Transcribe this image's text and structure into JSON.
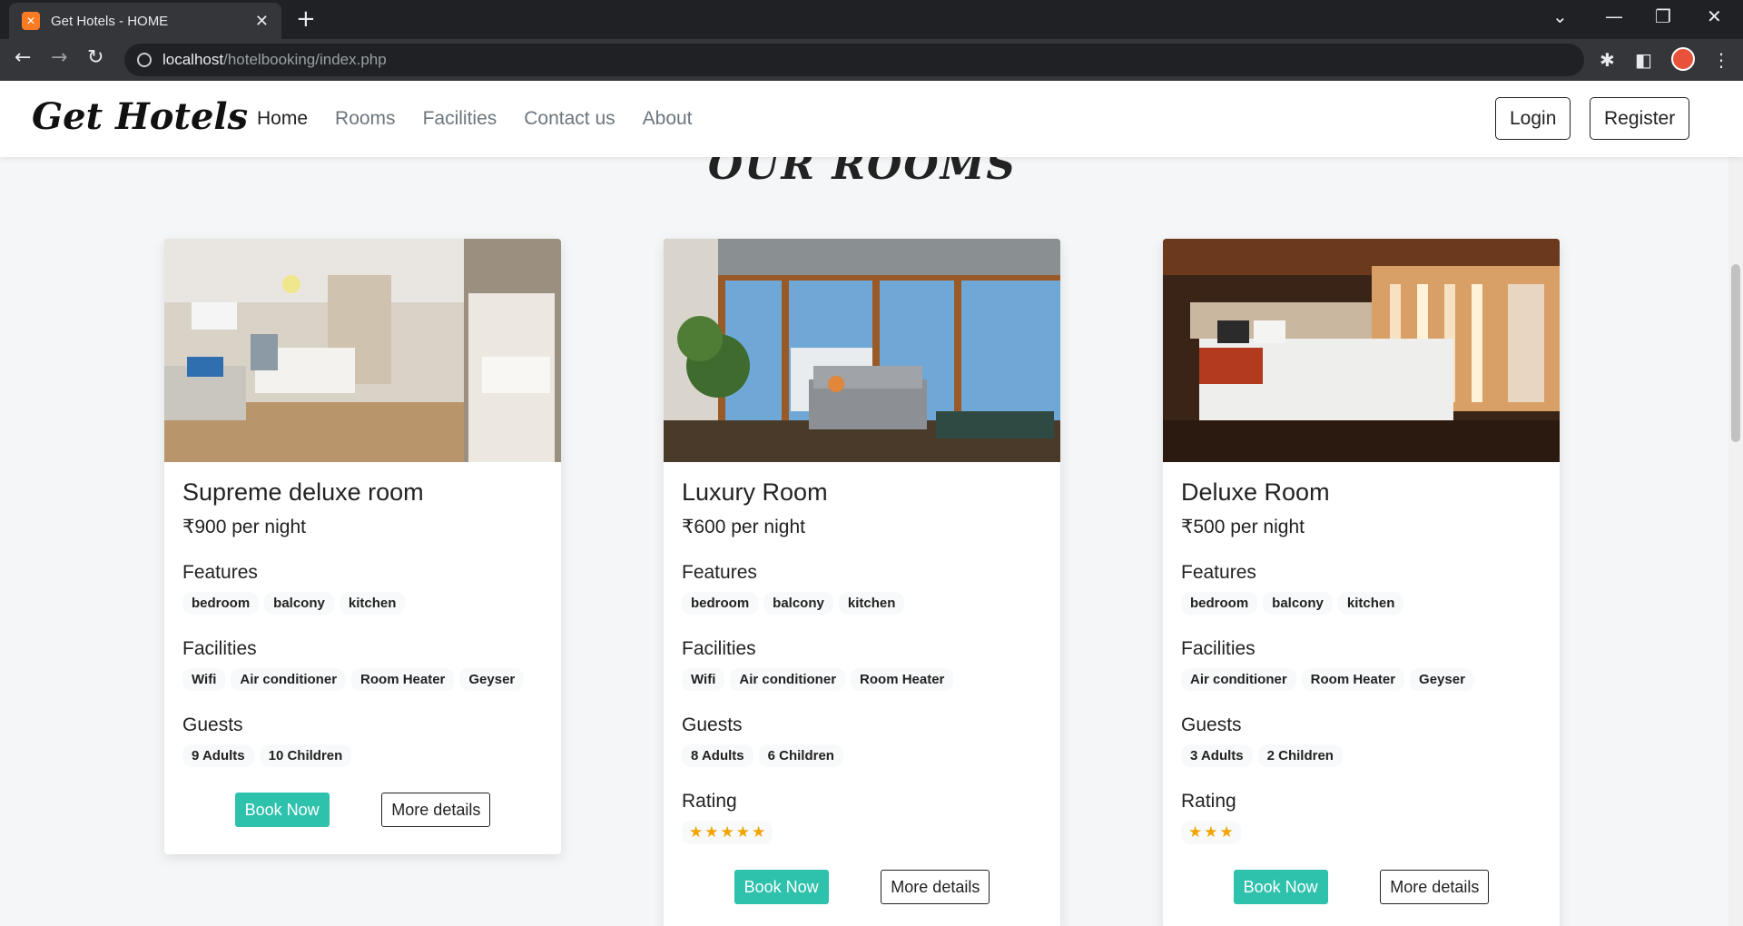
{
  "browser": {
    "tab_title": "Get Hotels - HOME",
    "tab_favicon": "xampp-icon",
    "close_glyph": "✕",
    "newtab_glyph": "+",
    "url_host": "localhost",
    "url_path": "/hotelbooking/index.php"
  },
  "site": {
    "brand": "Get Hotels",
    "nav": [
      "Home",
      "Rooms",
      "Facilities",
      "Contact us",
      "About"
    ],
    "login": "Login",
    "register": "Register",
    "section_title": "OUR ROOMS"
  },
  "labels": {
    "features": "Features",
    "facilities": "Facilities",
    "guests": "Guests",
    "rating": "Rating",
    "book_now": "Book Now",
    "more_details": "More details"
  },
  "rooms": [
    {
      "name": "Supreme deluxe room",
      "price": "₹900 per night",
      "features": [
        "bedroom",
        "balcony",
        "kitchen"
      ],
      "facilities": [
        "Wifi",
        "Air conditioner",
        "Room Heater",
        "Geyser"
      ],
      "guests": [
        "9 Adults",
        "10 Children"
      ],
      "rating": null
    },
    {
      "name": "Luxury Room",
      "price": "₹600 per night",
      "features": [
        "bedroom",
        "balcony",
        "kitchen"
      ],
      "facilities": [
        "Wifi",
        "Air conditioner",
        "Room Heater"
      ],
      "guests": [
        "8 Adults",
        "6 Children"
      ],
      "rating": 5
    },
    {
      "name": "Deluxe Room",
      "price": "₹500 per night",
      "features": [
        "bedroom",
        "balcony",
        "kitchen"
      ],
      "facilities": [
        "Air conditioner",
        "Room Heater",
        "Geyser"
      ],
      "guests": [
        "3 Adults",
        "2 Children"
      ],
      "rating": 3
    }
  ],
  "colors": {
    "accent": "#2ec1ac",
    "star": "#f2a400"
  }
}
